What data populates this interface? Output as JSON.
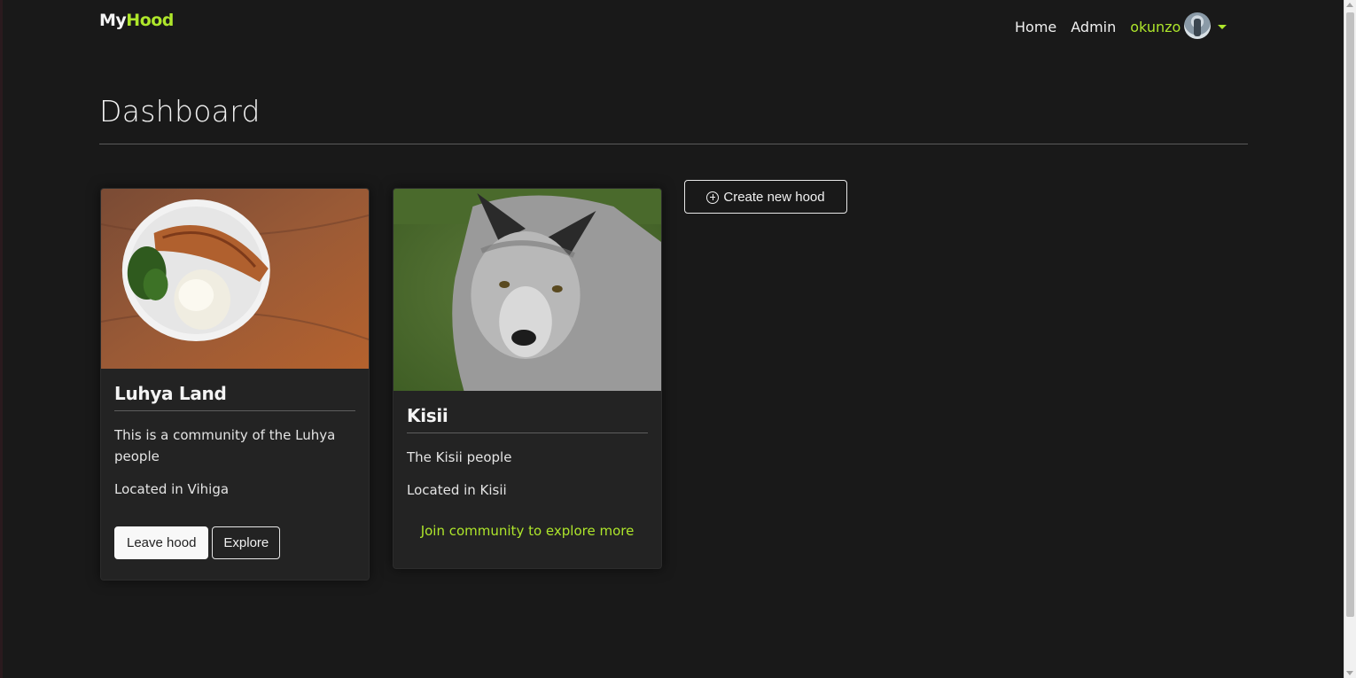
{
  "navbar": {
    "brand_prefix": "My",
    "brand_suffix": "Hood",
    "links": [
      "Home",
      "Admin"
    ],
    "username": "okunzo"
  },
  "page": {
    "title": "Dashboard"
  },
  "hoods": [
    {
      "name": "Luhya Land",
      "description": "This is a community of the Luhya people",
      "location": "Located in Vihiga",
      "actions": {
        "leave": "Leave hood",
        "explore": "Explore"
      }
    },
    {
      "name": "Kisii",
      "description": "The Kisii people",
      "location": "Located in Kisii",
      "join_text": "Join community to explore more"
    }
  ],
  "create_button": "Create new hood",
  "colors": {
    "accent": "#aee62b",
    "background": "#191919",
    "card": "#232323"
  }
}
